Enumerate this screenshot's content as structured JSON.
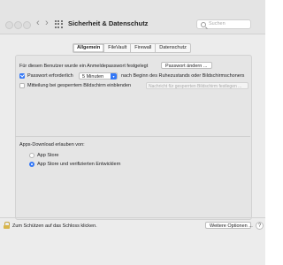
{
  "window": {
    "title": "Sicherheit & Datenschutz",
    "nav_back": "‹",
    "nav_forward": "›"
  },
  "search": {
    "placeholder": "Suchen"
  },
  "tabs": [
    {
      "label": "Allgemein",
      "active": true
    },
    {
      "label": "FileVault",
      "active": false
    },
    {
      "label": "Firewall",
      "active": false
    },
    {
      "label": "Datenschutz",
      "active": false
    }
  ],
  "general": {
    "password_set_label": "Für diesen Benutzer wurde ein Anmeldepasswort festgelegt",
    "change_password_button": "Passwort ändern ...",
    "require_password": {
      "checked": true,
      "label": "Passwort erforderlich",
      "selected_value": "5 Minuten",
      "suffix": "nach Beginn des Ruhezustands oder Bildschirmschoners"
    },
    "show_message": {
      "checked": false,
      "label": "Mitteilung bei gesperrtem Bildschirm einblenden",
      "button": "Nachricht für gesperrten Bildschirm festlegen ..."
    }
  },
  "apps_download": {
    "heading": "Apps-Download erlauben von:",
    "options": [
      {
        "label": "App Store",
        "selected": false
      },
      {
        "label": "App Store und verifizierten Entwicklern",
        "selected": true
      }
    ]
  },
  "footer": {
    "lock_text": "Zum Schützen auf das Schloss klicken.",
    "advanced_button": "Weitere Optionen ...",
    "help": "?"
  },
  "colors": {
    "accent": "#3478f6",
    "window_bg": "#ececec"
  }
}
